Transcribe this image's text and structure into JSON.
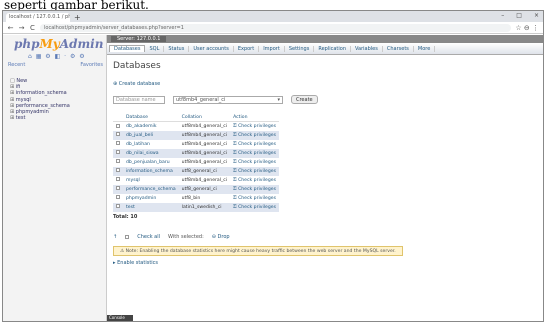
{
  "caption": "seperti gambar berikut.",
  "browser": {
    "tab_title": "localhost / 127.0.0.1 / phpMyAdmin",
    "tab_close": "×",
    "new_tab": "+",
    "win_min": "–",
    "win_max": "□",
    "win_close": "×",
    "url": "localhost/phpmyadmin/server_databases.php?server=1",
    "back": "←",
    "forward": "→",
    "reload": "C",
    "right_icons": "☆ ⊖ ⋮"
  },
  "sidebar": {
    "logo_php": "php",
    "logo_my": "My",
    "logo_admin": "Admin",
    "icons": "⌂ ▦ ⚙ ◧ · ⚙ ⚙",
    "recent": "Recent",
    "favorites": "Favorites",
    "tree": [
      {
        "label": "New",
        "prefix": "□"
      },
      {
        "label": "ifi",
        "prefix": "⊞"
      },
      {
        "label": "information_schema",
        "prefix": "⊞"
      },
      {
        "label": "mysql",
        "prefix": "⊞"
      },
      {
        "label": "performance_schema",
        "prefix": "⊞"
      },
      {
        "label": "phpmyadmin",
        "prefix": "⊞"
      },
      {
        "label": "test",
        "prefix": "⊞"
      }
    ]
  },
  "server_bar": "Server: 127.0.0.1",
  "tabs": [
    {
      "label": "Databases",
      "active": true
    },
    {
      "label": "SQL",
      "active": false
    },
    {
      "label": "Status",
      "active": false
    },
    {
      "label": "User accounts",
      "active": false
    },
    {
      "label": "Export",
      "active": false
    },
    {
      "label": "Import",
      "active": false
    },
    {
      "label": "Settings",
      "active": false
    },
    {
      "label": "Replication",
      "active": false
    },
    {
      "label": "Variables",
      "active": false
    },
    {
      "label": "Charsets",
      "active": false
    },
    {
      "label": "More",
      "active": false
    }
  ],
  "page_title": "Databases",
  "create_db_label": "Create database",
  "db_name_placeholder": "Database name",
  "collation_value": "utf8mb4_general_ci",
  "create_button": "Create",
  "table": {
    "headers": [
      "Database",
      "Collation",
      "Action"
    ],
    "rows": [
      {
        "name": "db_akademik",
        "collation": "utf8mb4_general_ci",
        "action": "Check privileges"
      },
      {
        "name": "db_jual_beli",
        "collation": "utf8mb4_general_ci",
        "action": "Check privileges"
      },
      {
        "name": "db_latihan",
        "collation": "utf8mb4_general_ci",
        "action": "Check privileges"
      },
      {
        "name": "db_nilai_siswa",
        "collation": "utf8mb4_general_ci",
        "action": "Check privileges"
      },
      {
        "name": "db_penjualan_baru",
        "collation": "utf8mb4_general_ci",
        "action": "Check privileges"
      },
      {
        "name": "information_schema",
        "collation": "utf8_general_ci",
        "action": "Check privileges"
      },
      {
        "name": "mysql",
        "collation": "utf8mb4_general_ci",
        "action": "Check privileges"
      },
      {
        "name": "performance_schema",
        "collation": "utf8_general_ci",
        "action": "Check privileges"
      },
      {
        "name": "phpmyadmin",
        "collation": "utf8_bin",
        "action": "Check privileges"
      },
      {
        "name": "test",
        "collation": "latin1_swedish_ci",
        "action": "Check privileges"
      }
    ]
  },
  "total": "Total: 10",
  "check_all": "Check all",
  "with_selected": "With selected:",
  "drop": "Drop",
  "notice": "Note: Enabling the database statistics here might cause heavy traffic between the web server and the MySQL server.",
  "enable_stats": "Enable statistics",
  "console": "Console"
}
